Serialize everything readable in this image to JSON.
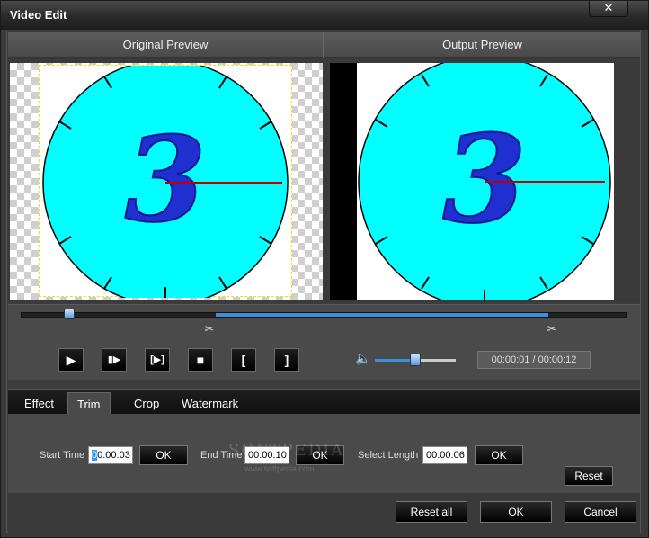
{
  "window": {
    "title": "Video Edit",
    "close_label": "✕"
  },
  "preview": {
    "original_label": "Original Preview",
    "output_label": "Output Preview",
    "clock_digit": "3",
    "clock_face_color": "#00ffff",
    "digit_color": "#1f2fd0",
    "hand_color": "#c00000"
  },
  "timeline": {
    "position_fraction": 0.08,
    "trim_start_fraction": 0.32,
    "trim_end_fraction": 0.87
  },
  "controls": {
    "play_icon": "▶",
    "next_frame_icon": "▮▶",
    "trim_play_icon": "[▶]",
    "stop_icon": "■",
    "mark_in_icon": "[",
    "mark_out_icon": "]",
    "volume_icon": "🔈",
    "volume_fraction": 0.5,
    "time_display": "00:00:01 / 00:00:12"
  },
  "tabs": [
    {
      "label": "Effect"
    },
    {
      "label": "Trim"
    },
    {
      "label": "Crop"
    },
    {
      "label": "Watermark"
    }
  ],
  "trim": {
    "start_label": "Start Time",
    "start_caret": "0",
    "start_value": "0:00:03",
    "end_label": "End Time",
    "end_value": "00:00:10",
    "length_label": "Select Length",
    "length_value": "00:00:06",
    "ok_label": "OK",
    "reset_label": "Reset"
  },
  "watermark": {
    "text": "SOFTPEDIA",
    "url": "www.softpedia.com"
  },
  "footer": {
    "reset_all_label": "Reset all",
    "ok_label": "OK",
    "cancel_label": "Cancel"
  }
}
